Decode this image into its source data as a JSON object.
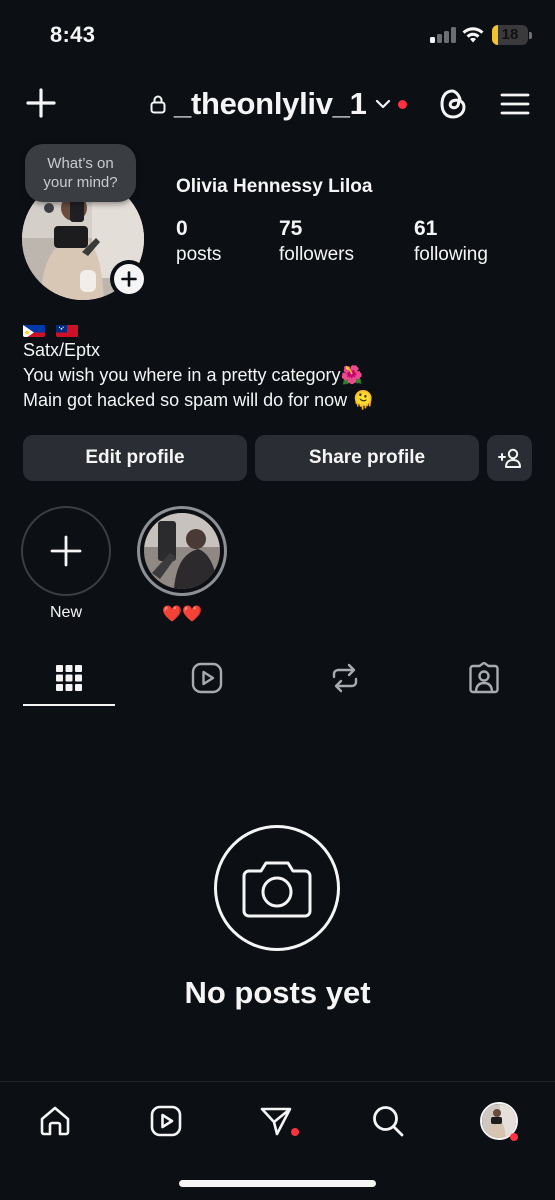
{
  "status_bar": {
    "time": "8:43",
    "battery_level": "18",
    "battery_fraction": 0.18
  },
  "header": {
    "username": "_theonlyliv_1",
    "icons": [
      "plus-icon",
      "lock-icon",
      "chevron-down-icon",
      "threads-icon",
      "menu-icon"
    ],
    "notification_dot_color": "#ff3040"
  },
  "profile": {
    "note_placeholder_line1": "What’s on",
    "note_placeholder_line2": "your mind?",
    "full_name": "Olivia Hennessy Liloa",
    "stats": [
      {
        "value": "0",
        "label": "posts"
      },
      {
        "value": "75",
        "label": "followers"
      },
      {
        "value": "61",
        "label": "following"
      }
    ],
    "bio": {
      "flags": [
        "philippines-flag",
        "samoa-flag"
      ],
      "line1": "Satx/Eptx",
      "line2": "You wish you where in a pretty category",
      "line2_emoji": "🌺",
      "line3": "Main got hacked so spam will do for now",
      "line3_emoji": "🫠"
    }
  },
  "actions": {
    "edit_profile": "Edit profile",
    "share_profile": "Share profile"
  },
  "highlights": [
    {
      "label": "New",
      "type": "new"
    },
    {
      "label": "❤️❤️",
      "type": "story"
    }
  ],
  "tabs": [
    "grid-icon",
    "reels-icon",
    "reposts-icon",
    "tagged-icon"
  ],
  "empty_state": {
    "title": "No posts yet"
  },
  "bottom_nav": [
    "home-icon",
    "reels-icon",
    "direct-messages-icon",
    "search-icon",
    "profile-avatar"
  ],
  "colors": {
    "background": "#0c0f14",
    "button": "#2a2d33",
    "accent_red": "#ff3040",
    "battery_yellow": "#f4c430"
  }
}
